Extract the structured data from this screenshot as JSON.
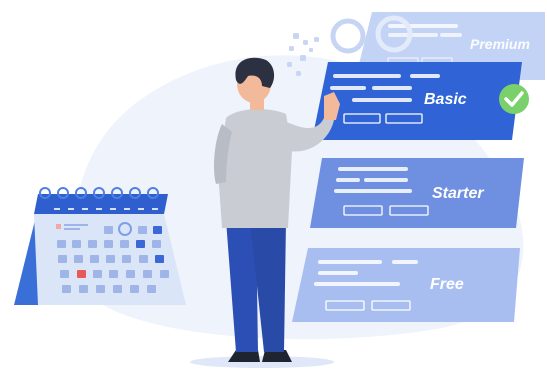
{
  "plans": [
    {
      "label": "Premium"
    },
    {
      "label": "Basic",
      "selected": true
    },
    {
      "label": "Starter"
    },
    {
      "label": "Free"
    }
  ],
  "icons": {
    "selected_marker": "checkmark-icon",
    "calendar": "calendar-icon"
  },
  "colors": {
    "primary_blue": "#2f63d6",
    "mid_blue": "#6f8fe0",
    "light_blue": "#a9bef0",
    "check_green": "#7ad06a",
    "background_blob": "#eef3fc"
  }
}
